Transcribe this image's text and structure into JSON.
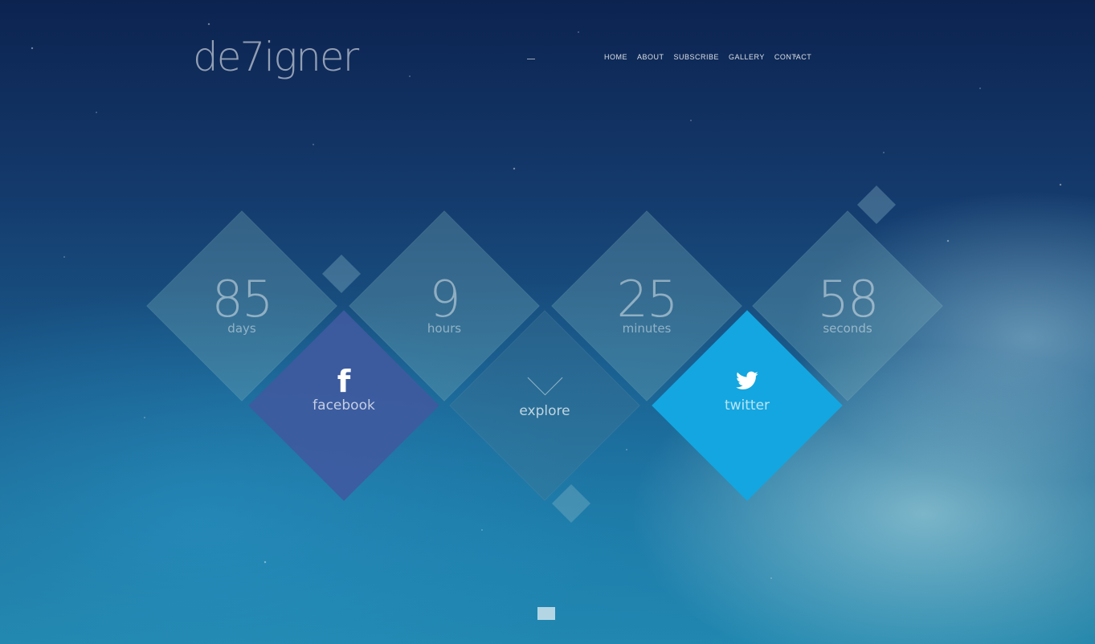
{
  "header": {
    "logo": "de7igner",
    "nav": [
      "HOME",
      "ABOUT",
      "SUBSCRIBE",
      "GALLERY",
      "CONTACT"
    ]
  },
  "countdown": [
    {
      "value": "85",
      "unit": "days"
    },
    {
      "value": "9",
      "unit": "hours"
    },
    {
      "value": "25",
      "unit": "minutes"
    },
    {
      "value": "58",
      "unit": "seconds"
    }
  ],
  "social": {
    "facebook": {
      "label": "facebook",
      "icon": "facebook-icon"
    },
    "explore": {
      "label": "explore",
      "icon": "chevron-down-icon"
    },
    "twitter": {
      "label": "twitter",
      "icon": "twitter-icon"
    }
  },
  "colors": {
    "facebook": "#3f5aa0",
    "twitter": "#14a6e0"
  }
}
